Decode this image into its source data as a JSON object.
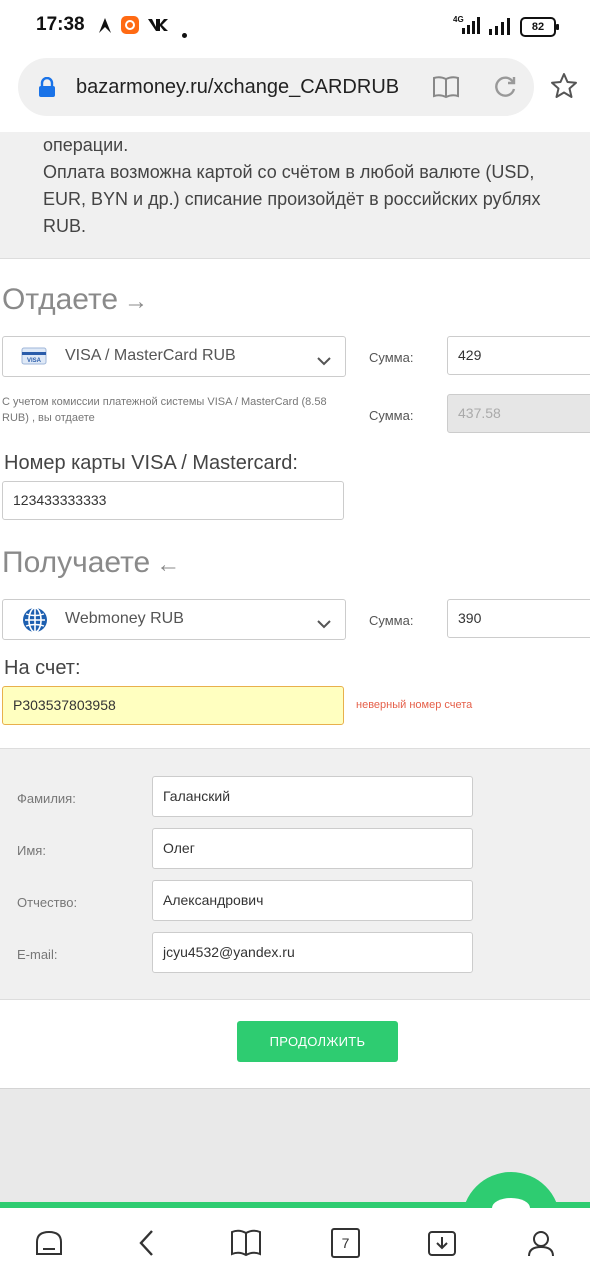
{
  "status_bar": {
    "time": "17:38",
    "network": "4G",
    "battery": "82"
  },
  "browser": {
    "url": "bazarmoney.ru/xchange_CARDRUB"
  },
  "notice": {
    "line1": "операции.",
    "line2": "Оплата возможна картой со счётом в любой валюте (USD, EUR, BYN и др.) списание произойдёт в российских рублях RUB.",
    "line2a": "Оплата возможна картой со счётом в любой валюте (USD,",
    "line2b": "EUR, BYN и др.) списание произойдёт в российских рублях",
    "line2c": "RUB."
  },
  "give": {
    "heading": "Отдаете",
    "arrow": "→",
    "currency": "VISA / MasterCard RUB",
    "amount_label": "Сумма:",
    "amount": "429",
    "commission_hint": "С учетом комиссии платежной системы VISA / MasterCard (8.58 RUB) , вы отдаете",
    "total_label": "Сумма:",
    "total": "437.58",
    "card_label": "Номер карты VISA / Mastercard:",
    "card_number": "123433333333"
  },
  "receive": {
    "heading": "Получаете",
    "arrow": "←",
    "currency": "Webmoney RUB",
    "amount_label": "Сумма:",
    "amount": "390",
    "account_label": "На счет:",
    "account": "P303537803958",
    "error": "неверный номер счета"
  },
  "personal": {
    "last_name_label": "Фамилия:",
    "last_name": "Галанский",
    "first_name_label": "Имя:",
    "first_name": "Олег",
    "middle_name_label": "Отчество:",
    "middle_name": "Александрович",
    "email_label": "E-mail:",
    "email": "jcyu4532@yandex.ru"
  },
  "continue_button": "ПРОДОЛЖИТЬ",
  "bottom_nav": {
    "tabs_count": "7"
  },
  "colors": {
    "accent": "#2ecc71",
    "error": "#e5604a",
    "error_bg": "#ffffc0"
  }
}
